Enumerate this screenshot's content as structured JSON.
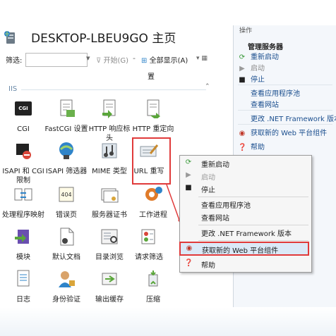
{
  "header": {
    "title": "DESKTOP-LBEU9GO 主页"
  },
  "filter": {
    "label": "筛选:",
    "input_value": "",
    "go_label": "开始(G)",
    "show_all_label": "全部显示(A)",
    "partial_labels": [
      "置"
    ]
  },
  "section": {
    "title": "IIS"
  },
  "features": [
    {
      "icon": "cgi-icon",
      "label": "CGI"
    },
    {
      "icon": "fastcgi-icon",
      "label": "FastCGI 设置"
    },
    {
      "icon": "http-response-headers-icon",
      "label": "HTTP 响应标头"
    },
    {
      "icon": "http-redirect-icon",
      "label": "HTTP 重定向"
    },
    {
      "icon": "isapi-cgi-restrictions-icon",
      "label": "ISAPI 和 CGI 限制"
    },
    {
      "icon": "isapi-filters-icon",
      "label": "ISAPI 筛选器"
    },
    {
      "icon": "mime-types-icon",
      "label": "MIME 类型"
    },
    {
      "icon": "url-rewrite-icon",
      "label": "URL 重写"
    },
    {
      "icon": "handler-mappings-icon",
      "label": "处理程序映射"
    },
    {
      "icon": "error-pages-icon",
      "label": "错误页"
    },
    {
      "icon": "server-certificates-icon",
      "label": "服务器证书"
    },
    {
      "icon": "worker-processes-icon",
      "label": "工作进程"
    },
    {
      "icon": "modules-icon",
      "label": "模块"
    },
    {
      "icon": "default-document-icon",
      "label": "默认文档"
    },
    {
      "icon": "directory-browsing-icon",
      "label": "目录浏览"
    },
    {
      "icon": "request-filtering-icon",
      "label": "请求筛选"
    },
    {
      "icon": "logging-icon",
      "label": "日志"
    },
    {
      "icon": "authentication-icon",
      "label": "身份验证"
    },
    {
      "icon": "output-caching-icon",
      "label": "输出缓存"
    },
    {
      "icon": "compression-icon",
      "label": "压缩"
    }
  ],
  "actions_pane": {
    "header_partial": "操作",
    "group_title": "管理服务器",
    "items": [
      {
        "icon": "restart-icon",
        "label": "重新启动",
        "enabled": true
      },
      {
        "icon": "start-icon",
        "label": "启动",
        "enabled": false
      },
      {
        "icon": "stop-icon",
        "label": "停止",
        "enabled": true
      },
      {
        "icon": "",
        "label": "查看应用程序池",
        "enabled": true
      },
      {
        "icon": "",
        "label": "查看网站",
        "enabled": true
      },
      {
        "icon": "",
        "label": "更改 .NET Framework 版本",
        "enabled": true
      },
      {
        "icon": "web-platform-icon",
        "label": "获取新的 Web 平台组件",
        "enabled": true
      },
      {
        "icon": "help-icon",
        "label": "帮助",
        "enabled": true
      }
    ]
  },
  "context_menu": {
    "items": [
      {
        "icon": "restart-icon",
        "label": "重新启动",
        "enabled": true
      },
      {
        "icon": "start-icon",
        "label": "启动",
        "enabled": false
      },
      {
        "icon": "stop-icon",
        "label": "停止",
        "enabled": true
      },
      {
        "icon": "",
        "label": "查看应用程序池",
        "enabled": true
      },
      {
        "icon": "",
        "label": "查看网站",
        "enabled": true
      },
      {
        "icon": "",
        "label": "更改 .NET Framework 版本",
        "enabled": true
      },
      {
        "icon": "web-platform-icon",
        "label": "获取新的 Web 平台组件",
        "enabled": true,
        "highlighted": true
      },
      {
        "icon": "help-icon",
        "label": "帮助",
        "enabled": true
      }
    ]
  },
  "colors": {
    "annotation_red": "#e03a3a",
    "link_blue": "#1a4e8e",
    "highlight_bg": "#dbe9f7"
  }
}
